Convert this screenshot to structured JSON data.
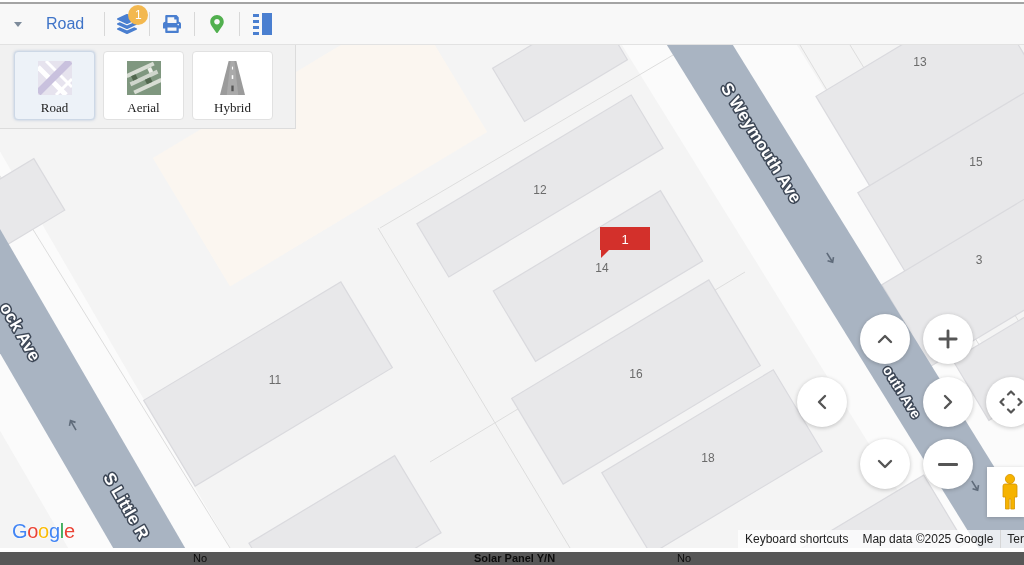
{
  "toolbar": {
    "map_type": {
      "label": "Road",
      "expanded": true
    },
    "layers": {
      "badge": "1"
    }
  },
  "map_type_menu": [
    {
      "kind": "road",
      "label": "Road",
      "selected": true
    },
    {
      "kind": "aerial",
      "label": "Aerial",
      "selected": false
    },
    {
      "kind": "hybrid",
      "label": "Hybrid",
      "selected": false
    }
  ],
  "map": {
    "streets": [
      {
        "label": "S Weymouth Ave"
      },
      {
        "label": "outh Ave"
      },
      {
        "label": "ock Ave"
      },
      {
        "label": "S Little R"
      }
    ],
    "buildings": [
      {
        "number": "13"
      },
      {
        "number": "15"
      },
      {
        "number": "12"
      },
      {
        "number": "3"
      },
      {
        "number": "14"
      },
      {
        "number": "16"
      },
      {
        "number": "11"
      },
      {
        "number": "18"
      }
    ],
    "marker": {
      "label": "1"
    },
    "logo": "Google",
    "attribution": [
      "Keyboard shortcuts",
      "Map data ©2025 Google",
      "Ter"
    ]
  },
  "details_row": [
    {
      "kind": "value",
      "text": "No"
    },
    {
      "kind": "label",
      "text": "Solar Panel Y/N"
    },
    {
      "kind": "value",
      "text": "No"
    }
  ]
}
